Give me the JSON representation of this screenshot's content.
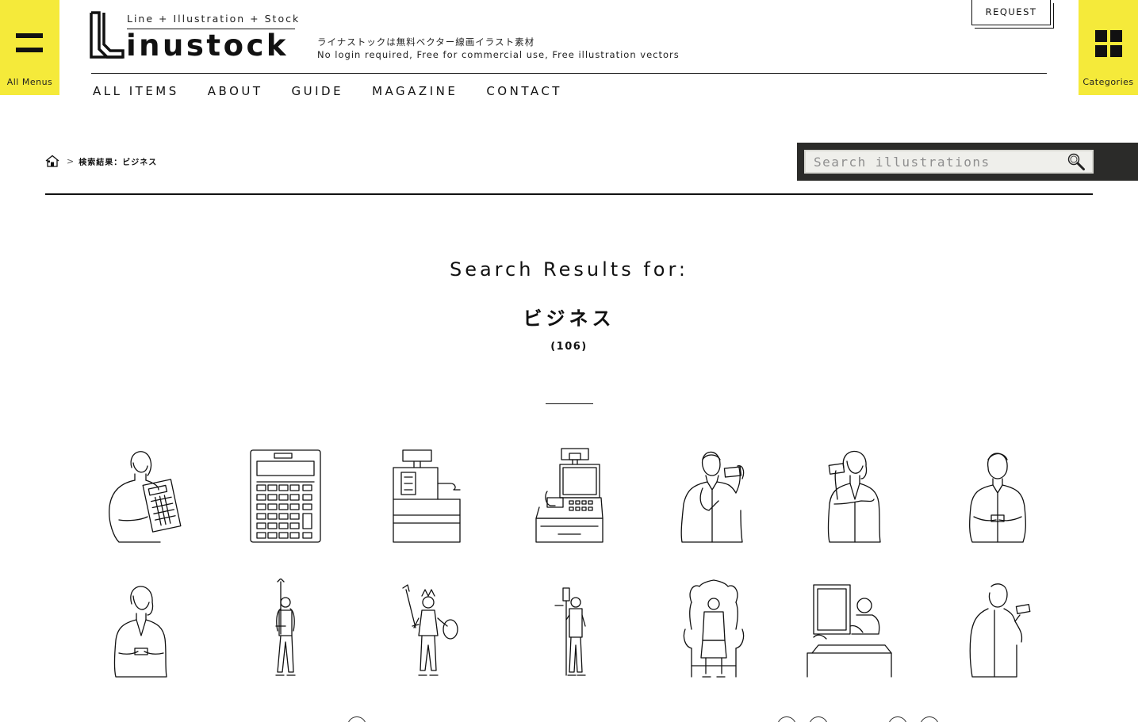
{
  "header": {
    "all_menus_label": "All Menus",
    "categories_label": "Categories",
    "logo_tagline": "Line + Illustration + Stock",
    "logo_word": "inustock",
    "site_desc_ja": "ライナストックは無料ベクター線画イラスト素材",
    "site_desc_en": "No login required, Free for commercial use, Free illustration vectors",
    "request_label": "REQUEST",
    "nav": [
      "ALL ITEMS",
      "ABOUT",
      "GUIDE",
      "MAGAZINE",
      "CONTACT"
    ]
  },
  "breadcrumb": {
    "current": "検索結果：ビジネス"
  },
  "search": {
    "placeholder": "Search illustrations"
  },
  "results": {
    "title": "Search Results for:",
    "term": "ビジネス",
    "count": "(106)"
  },
  "items": [
    {
      "icon": "woman-with-calculator-icon"
    },
    {
      "icon": "calculator-icon"
    },
    {
      "icon": "cash-register-icon"
    },
    {
      "icon": "pos-register-icon"
    },
    {
      "icon": "businessman-showing-card-icon"
    },
    {
      "icon": "businesswoman-showing-card-icon"
    },
    {
      "icon": "businessman-holding-card-icon"
    },
    {
      "icon": "businesswoman-holding-card-icon"
    },
    {
      "icon": "businessman-with-sword-icon"
    },
    {
      "icon": "businesswoman-warrior-icon"
    },
    {
      "icon": "businessman-with-staff-icon"
    },
    {
      "icon": "businessman-on-throne-icon"
    },
    {
      "icon": "businessman-with-frame-icon"
    },
    {
      "icon": "businessman-with-phone-icon"
    }
  ],
  "colors": {
    "accent_yellow": "#f5ea3a",
    "search_bg": "#2b2b29",
    "text": "#111111"
  }
}
